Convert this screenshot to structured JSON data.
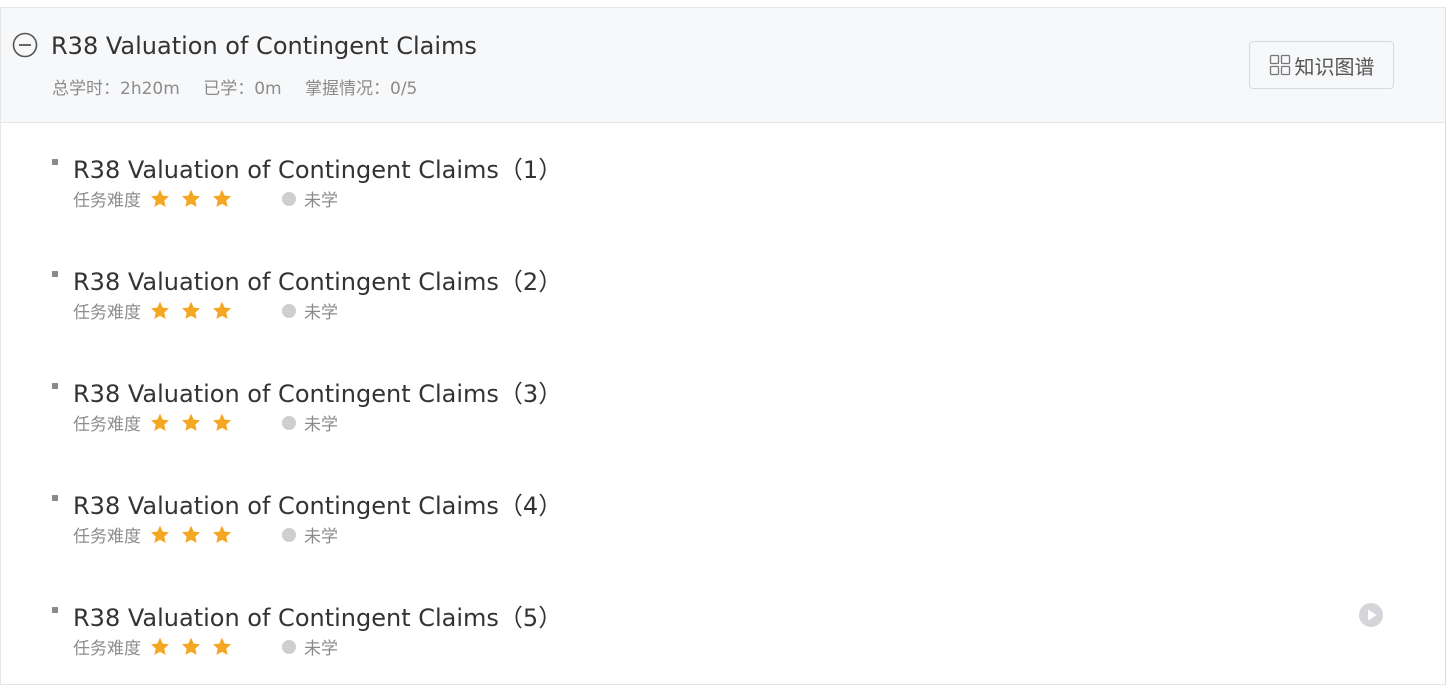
{
  "chapter": {
    "title": "R38 Valuation of Contingent Claims",
    "total_time": "总学时：2h20m",
    "studied": "已学：0m",
    "mastery": "掌握情况：0/5",
    "knowledge_map_label": "知识图谱"
  },
  "difficulty_label": "任务难度",
  "lessons": [
    {
      "title": "R38 Valuation of Contingent Claims（1）",
      "difficulty_stars": 3,
      "status": "未学"
    },
    {
      "title": "R38 Valuation of Contingent Claims（2）",
      "difficulty_stars": 3,
      "status": "未学"
    },
    {
      "title": "R38 Valuation of Contingent Claims（3）",
      "difficulty_stars": 3,
      "status": "未学"
    },
    {
      "title": "R38 Valuation of Contingent Claims（4）",
      "difficulty_stars": 3,
      "status": "未学"
    },
    {
      "title": "R38 Valuation of Contingent Claims（5）",
      "difficulty_stars": 3,
      "status": "未学"
    }
  ],
  "colors": {
    "star": "#f5a623",
    "status_dot": "#cfcfcf",
    "header_bg": "#f7f8fa"
  },
  "icons": {
    "collapse": "minus-circle-icon",
    "knowledge_map": "grid-icon",
    "star": "star-icon",
    "play": "play-circle-icon"
  }
}
